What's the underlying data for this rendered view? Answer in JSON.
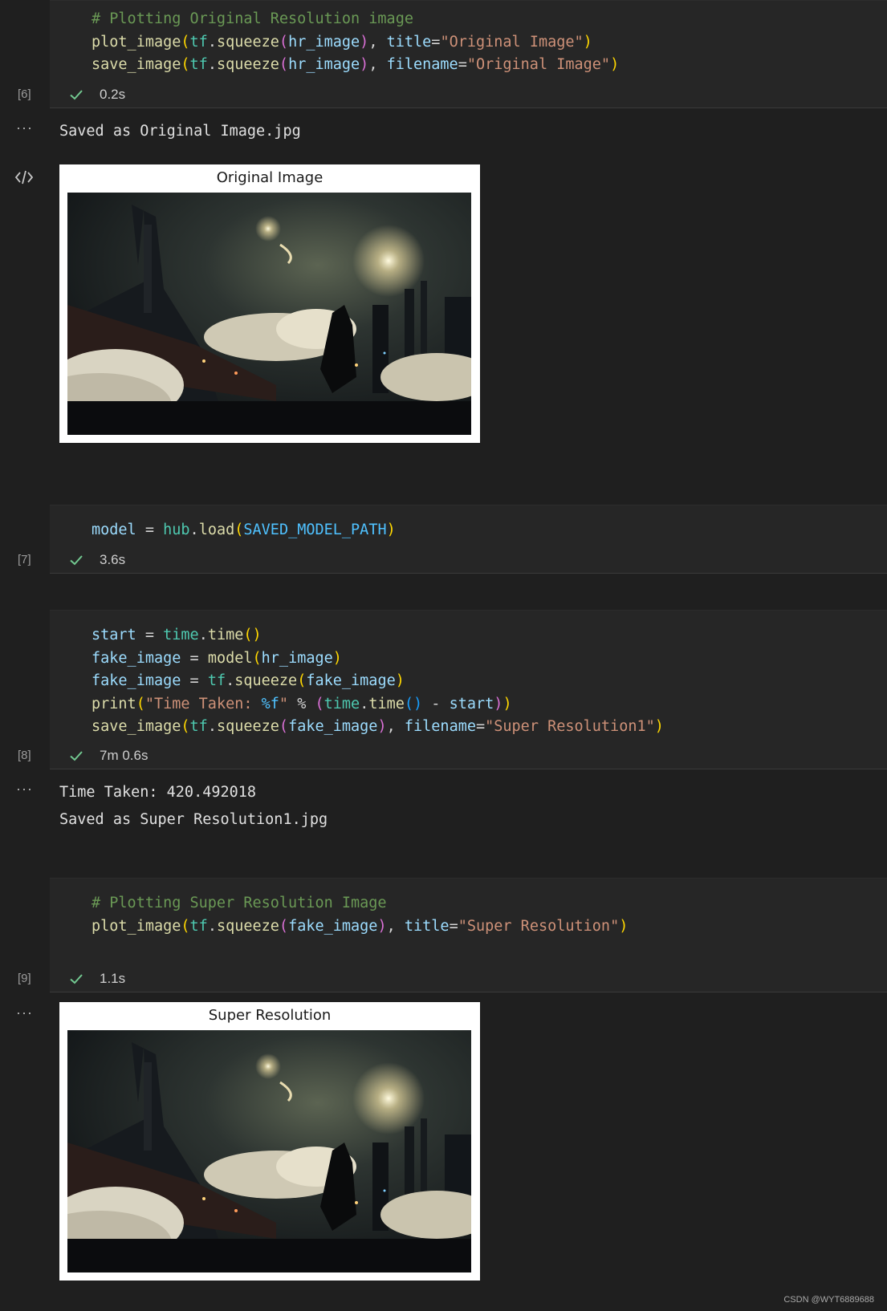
{
  "cells": [
    {
      "exec_count": "[6]",
      "duration": "0.2s",
      "lines": [
        [
          {
            "t": "# Plotting Original Resolution image",
            "c": "c-com"
          }
        ],
        [
          {
            "t": "plot_image",
            "c": "c-fn"
          },
          {
            "t": "(",
            "c": "c-p1"
          },
          {
            "t": "tf",
            "c": "c-mod"
          },
          {
            "t": ".",
            "c": "c-op"
          },
          {
            "t": "squeeze",
            "c": "c-fn"
          },
          {
            "t": "(",
            "c": "c-p2"
          },
          {
            "t": "hr_image",
            "c": "c-var"
          },
          {
            "t": ")",
            "c": "c-p2"
          },
          {
            "t": ", ",
            "c": "c-op"
          },
          {
            "t": "title",
            "c": "c-var"
          },
          {
            "t": "=",
            "c": "c-op"
          },
          {
            "t": "\"Original Image\"",
            "c": "c-str"
          },
          {
            "t": ")",
            "c": "c-p1"
          }
        ],
        [
          {
            "t": "save_image",
            "c": "c-fn"
          },
          {
            "t": "(",
            "c": "c-p1"
          },
          {
            "t": "tf",
            "c": "c-mod"
          },
          {
            "t": ".",
            "c": "c-op"
          },
          {
            "t": "squeeze",
            "c": "c-fn"
          },
          {
            "t": "(",
            "c": "c-p2"
          },
          {
            "t": "hr_image",
            "c": "c-var"
          },
          {
            "t": ")",
            "c": "c-p2"
          },
          {
            "t": ", ",
            "c": "c-op"
          },
          {
            "t": "filename",
            "c": "c-var"
          },
          {
            "t": "=",
            "c": "c-op"
          },
          {
            "t": "\"Original Image\"",
            "c": "c-str"
          },
          {
            "t": ")",
            "c": "c-p1"
          }
        ]
      ]
    },
    {
      "exec_count": "[7]",
      "duration": "3.6s",
      "lines": [
        [
          {
            "t": "model",
            "c": "c-var"
          },
          {
            "t": " = ",
            "c": "c-op"
          },
          {
            "t": "hub",
            "c": "c-mod"
          },
          {
            "t": ".",
            "c": "c-op"
          },
          {
            "t": "load",
            "c": "c-fn"
          },
          {
            "t": "(",
            "c": "c-p1"
          },
          {
            "t": "SAVED_MODEL_PATH",
            "c": "c-const"
          },
          {
            "t": ")",
            "c": "c-p1"
          }
        ]
      ]
    },
    {
      "exec_count": "[8]",
      "duration": "7m 0.6s",
      "lines": [
        [
          {
            "t": "start",
            "c": "c-var"
          },
          {
            "t": " = ",
            "c": "c-op"
          },
          {
            "t": "time",
            "c": "c-mod"
          },
          {
            "t": ".",
            "c": "c-op"
          },
          {
            "t": "time",
            "c": "c-fn"
          },
          {
            "t": "()",
            "c": "c-p1"
          }
        ],
        [
          {
            "t": "fake_image",
            "c": "c-var"
          },
          {
            "t": " = ",
            "c": "c-op"
          },
          {
            "t": "model",
            "c": "c-fn"
          },
          {
            "t": "(",
            "c": "c-p1"
          },
          {
            "t": "hr_image",
            "c": "c-var"
          },
          {
            "t": ")",
            "c": "c-p1"
          }
        ],
        [
          {
            "t": "fake_image",
            "c": "c-var"
          },
          {
            "t": " = ",
            "c": "c-op"
          },
          {
            "t": "tf",
            "c": "c-mod"
          },
          {
            "t": ".",
            "c": "c-op"
          },
          {
            "t": "squeeze",
            "c": "c-fn"
          },
          {
            "t": "(",
            "c": "c-p1"
          },
          {
            "t": "fake_image",
            "c": "c-var"
          },
          {
            "t": ")",
            "c": "c-p1"
          }
        ],
        [
          {
            "t": "print",
            "c": "c-fn"
          },
          {
            "t": "(",
            "c": "c-p1"
          },
          {
            "t": "\"Time Taken: ",
            "c": "c-str"
          },
          {
            "t": "%f",
            "c": "c-const"
          },
          {
            "t": "\"",
            "c": "c-str"
          },
          {
            "t": " % ",
            "c": "c-op"
          },
          {
            "t": "(",
            "c": "c-p2"
          },
          {
            "t": "time",
            "c": "c-mod"
          },
          {
            "t": ".",
            "c": "c-op"
          },
          {
            "t": "time",
            "c": "c-fn"
          },
          {
            "t": "()",
            "c": "c-p3"
          },
          {
            "t": " - ",
            "c": "c-op"
          },
          {
            "t": "start",
            "c": "c-var"
          },
          {
            "t": ")",
            "c": "c-p2"
          },
          {
            "t": ")",
            "c": "c-p1"
          }
        ],
        [
          {
            "t": "save_image",
            "c": "c-fn"
          },
          {
            "t": "(",
            "c": "c-p1"
          },
          {
            "t": "tf",
            "c": "c-mod"
          },
          {
            "t": ".",
            "c": "c-op"
          },
          {
            "t": "squeeze",
            "c": "c-fn"
          },
          {
            "t": "(",
            "c": "c-p2"
          },
          {
            "t": "fake_image",
            "c": "c-var"
          },
          {
            "t": ")",
            "c": "c-p2"
          },
          {
            "t": ", ",
            "c": "c-op"
          },
          {
            "t": "filename",
            "c": "c-var"
          },
          {
            "t": "=",
            "c": "c-op"
          },
          {
            "t": "\"Super Resolution1\"",
            "c": "c-str"
          },
          {
            "t": ")",
            "c": "c-p1"
          }
        ]
      ]
    },
    {
      "exec_count": "[9]",
      "duration": "1.1s",
      "lines": [
        [
          {
            "t": "# Plotting Super Resolution Image",
            "c": "c-com"
          }
        ],
        [
          {
            "t": "plot_image",
            "c": "c-fn"
          },
          {
            "t": "(",
            "c": "c-p1"
          },
          {
            "t": "tf",
            "c": "c-mod"
          },
          {
            "t": ".",
            "c": "c-op"
          },
          {
            "t": "squeeze",
            "c": "c-fn"
          },
          {
            "t": "(",
            "c": "c-p2"
          },
          {
            "t": "fake_image",
            "c": "c-var"
          },
          {
            "t": ")",
            "c": "c-p2"
          },
          {
            "t": ", ",
            "c": "c-op"
          },
          {
            "t": "title",
            "c": "c-var"
          },
          {
            "t": "=",
            "c": "c-op"
          },
          {
            "t": "\"Super Resolution\"",
            "c": "c-str"
          },
          {
            "t": ")",
            "c": "c-p1"
          }
        ]
      ]
    }
  ],
  "outputs": {
    "cell6_text": "Saved as Original Image.jpg",
    "cell6_figure_title": "Original Image",
    "cell8_line1": "Time Taken: 420.492018",
    "cell8_line2": "Saved as Super Resolution1.jpg",
    "cell9_figure_title": "Super Resolution"
  },
  "icons": {
    "output_menu": "more-horizontal-icon",
    "code_view": "code-icon",
    "success": "check-icon"
  },
  "ellipsis": "···",
  "watermark": "CSDN @WYT6889688",
  "colors": {
    "background": "#1f1f1f",
    "cell": "#262626",
    "check": "#73c991"
  }
}
